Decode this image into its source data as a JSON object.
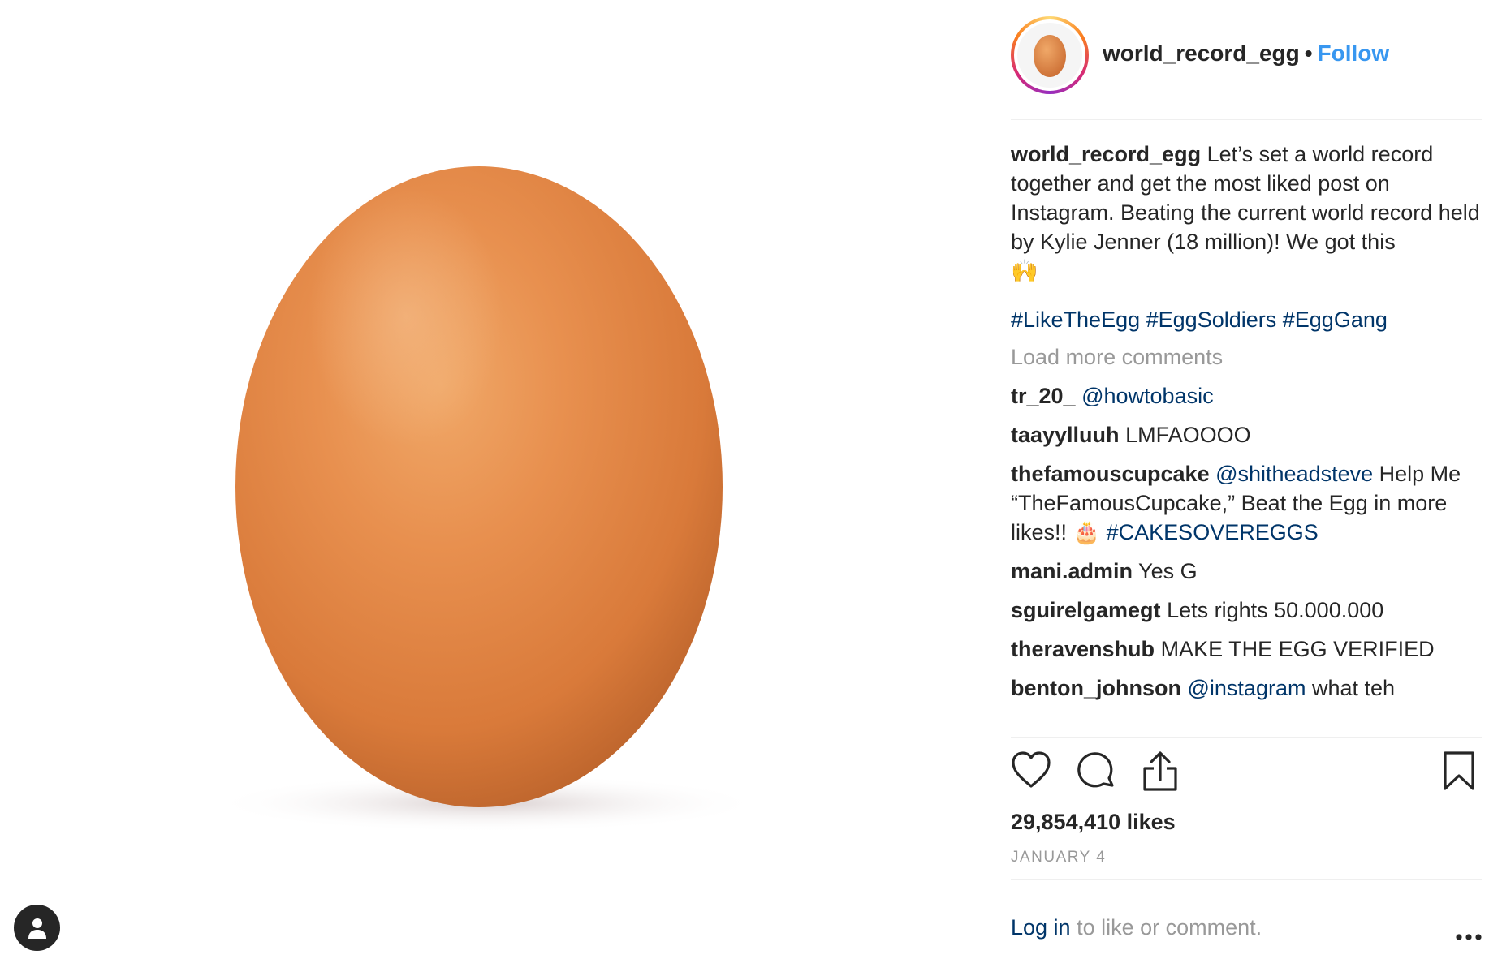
{
  "post": {
    "username": "world_record_egg",
    "separator": "•",
    "follow_label": "Follow",
    "caption": {
      "username": "world_record_egg",
      "text": "Let’s set a world record together and get the most liked post on Instagram. Beating the current world record held by Kylie Jenner (18 million)! We got this",
      "emoji": "🙌",
      "hashtags": [
        "#LikeTheEgg",
        "#EggSoldiers",
        "#EggGang"
      ]
    },
    "load_more_label": "Load more comments",
    "comments": [
      {
        "user": "tr_20_",
        "parts": [
          {
            "text": "@howtobasic",
            "link": true
          }
        ]
      },
      {
        "user": "taayylluuh",
        "parts": [
          {
            "text": "LMFAOOOO",
            "link": false
          }
        ]
      },
      {
        "user": "thefamouscupcake",
        "parts": [
          {
            "text": "@shitheadsteve",
            "link": true
          },
          {
            "text": " Help Me “TheFamousCupcake,” Beat the Egg in more likes!! 🎂 ",
            "link": false
          },
          {
            "text": "#CAKESOVEREGGS",
            "link": true
          }
        ]
      },
      {
        "user": "mani.admin",
        "parts": [
          {
            "text": "Yes G",
            "link": false
          }
        ]
      },
      {
        "user": "sguirelgamegt",
        "parts": [
          {
            "text": "Lets rights 50.000.000",
            "link": false
          }
        ]
      },
      {
        "user": "theravenshub",
        "parts": [
          {
            "text": "MAKE THE EGG VERIFIED",
            "link": false
          }
        ]
      },
      {
        "user": "benton_johnson",
        "parts": [
          {
            "text": "@instagram",
            "link": true
          },
          {
            "text": " what teh",
            "link": false
          }
        ]
      }
    ],
    "likes": "29,854,410 likes",
    "date": "JANUARY 4",
    "login_link": "Log in",
    "login_suffix": "to like or comment."
  },
  "icons": {
    "like": "heart-icon",
    "comment": "comment-bubble-icon",
    "share": "share-upload-icon",
    "save": "bookmark-icon",
    "more": "more-options-icon",
    "user": "user-silhouette-icon"
  },
  "colors": {
    "accent": "#3897f0",
    "link": "#003569",
    "muted": "#999999",
    "text": "#262626",
    "egg": "#e08a4a"
  }
}
